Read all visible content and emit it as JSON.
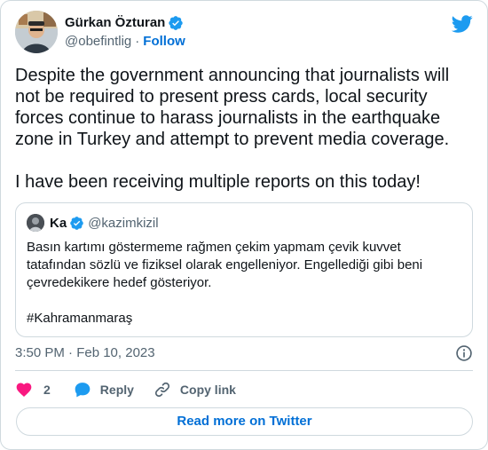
{
  "author": {
    "name": "Gürkan Özturan",
    "handle": "@obefintlig",
    "separator": "·",
    "follow_label": "Follow"
  },
  "tweet": {
    "text": "Despite the government announcing that journalists will not be required to present press cards, local security forces continue to harass journalists in the earthquake zone in Turkey and attempt to prevent media coverage.\n\nI have been receiving multiple reports on this today!"
  },
  "quote": {
    "name": "Ka",
    "handle": "@kazimkizil",
    "text": "Basın kartımı göstermeme rağmen çekim yapmam çevik kuvvet tatafından sözlü ve fiziksel olarak engelleniyor. Engellediği gibi beni çevredekikere hedef gösteriyor.\n\n#Kahramanmaraş"
  },
  "meta": {
    "timestamp": "3:50 PM · Feb 10, 2023"
  },
  "actions": {
    "like_count": "2",
    "reply_label": "Reply",
    "copy_label": "Copy link"
  },
  "read_more_label": "Read more on Twitter",
  "icons": {
    "twitter": "twitter-bird-icon",
    "verified": "verified-badge-icon",
    "info": "info-icon",
    "heart": "heart-icon",
    "reply": "reply-bubble-icon",
    "link": "link-icon"
  },
  "colors": {
    "accent": "#1d9bf0",
    "link": "#006fd6",
    "like": "#f91880",
    "text": "#0f1419",
    "muted": "#536471",
    "border": "#cfd9de"
  }
}
